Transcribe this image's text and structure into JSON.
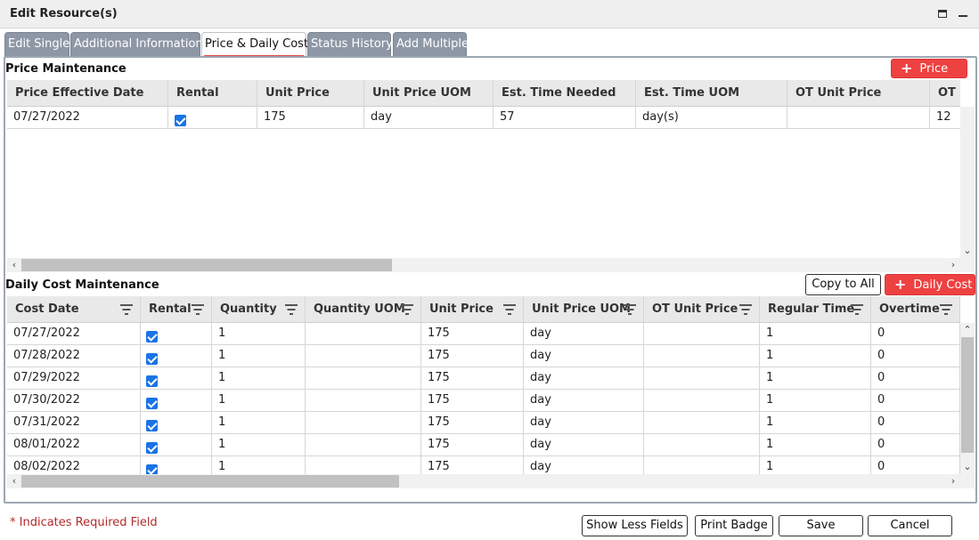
{
  "window": {
    "title": "Edit Resource(s)",
    "maximize_icon": "maximize-icon",
    "minimize_icon": "minimize-icon"
  },
  "tabs": [
    {
      "label": "Edit Single"
    },
    {
      "label": "Additional Information"
    },
    {
      "label": "Price & Daily Cost",
      "active": true
    },
    {
      "label": "Status History"
    },
    {
      "label": "Add Multiple"
    }
  ],
  "price_section": {
    "title": "Price Maintenance",
    "add_label": "Price",
    "columns": [
      "Price Effective Date",
      "Rental",
      "Unit Price",
      "Unit Price UOM",
      "Est. Time Needed",
      "Est. Time UOM",
      "OT Unit Price",
      "OT Unit Price UOM"
    ],
    "rows": [
      {
        "date": "07/27/2022",
        "rental": true,
        "unit_price": "175",
        "uom": "day",
        "est_time": "57",
        "est_uom": "day(s)",
        "ot_price": "",
        "ot_uom": "12"
      }
    ]
  },
  "daily_cost_section": {
    "title": "Daily Cost Maintenance",
    "copy_label": "Copy to All",
    "add_label": "Daily Cost",
    "columns": [
      "Cost Date",
      "Rental",
      "Quantity",
      "Quantity UOM",
      "Unit Price",
      "Unit Price UOM",
      "OT Unit Price",
      "Regular Time",
      "Overtime"
    ],
    "rows": [
      {
        "date": "07/27/2022",
        "rental": true,
        "qty": "1",
        "qty_uom": "",
        "unit_price": "175",
        "uom": "day",
        "ot_price": "",
        "reg": "1",
        "ot": "0"
      },
      {
        "date": "07/28/2022",
        "rental": true,
        "qty": "1",
        "qty_uom": "",
        "unit_price": "175",
        "uom": "day",
        "ot_price": "",
        "reg": "1",
        "ot": "0"
      },
      {
        "date": "07/29/2022",
        "rental": true,
        "qty": "1",
        "qty_uom": "",
        "unit_price": "175",
        "uom": "day",
        "ot_price": "",
        "reg": "1",
        "ot": "0"
      },
      {
        "date": "07/30/2022",
        "rental": true,
        "qty": "1",
        "qty_uom": "",
        "unit_price": "175",
        "uom": "day",
        "ot_price": "",
        "reg": "1",
        "ot": "0"
      },
      {
        "date": "07/31/2022",
        "rental": true,
        "qty": "1",
        "qty_uom": "",
        "unit_price": "175",
        "uom": "day",
        "ot_price": "",
        "reg": "1",
        "ot": "0"
      },
      {
        "date": "08/01/2022",
        "rental": true,
        "qty": "1",
        "qty_uom": "",
        "unit_price": "175",
        "uom": "day",
        "ot_price": "",
        "reg": "1",
        "ot": "0"
      },
      {
        "date": "08/02/2022",
        "rental": true,
        "qty": "1",
        "qty_uom": "",
        "unit_price": "175",
        "uom": "day",
        "ot_price": "",
        "reg": "1",
        "ot": "0"
      }
    ]
  },
  "footer": {
    "required_note": "* Indicates Required Field",
    "buttons": {
      "show_less": "Show Less Fields",
      "print_badge": "Print Badge",
      "save": "Save",
      "cancel": "Cancel"
    }
  },
  "colors": {
    "accent_red": "#ee4141",
    "tab_gray": "#8e97a5",
    "checkbox_blue": "#1a73e8",
    "required_red": "#b32a2a"
  }
}
